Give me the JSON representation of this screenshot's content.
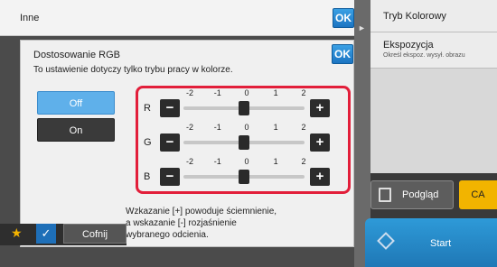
{
  "outer_dialog": {
    "title": "Inne",
    "ok_label": "OK"
  },
  "rgb_dialog": {
    "title": "Dostosowanie RGB",
    "ok_label": "OK",
    "description": "To ustawienie dotyczy tylko trybu pracy w kolorze.",
    "mode_off_label": "Off",
    "mode_on_label": "On",
    "selected_mode": "Off",
    "scale_labels": [
      "-2",
      "-1",
      "0",
      "1",
      "2"
    ],
    "channels": [
      {
        "label": "R",
        "value": 0
      },
      {
        "label": "G",
        "value": 0
      },
      {
        "label": "B",
        "value": 0
      }
    ],
    "minus_label": "−",
    "plus_label": "+",
    "note_lines": [
      "Wzkazanie [+] powoduje ściemnienie,",
      "a wskazanie [-] rozjaśnienie",
      "wybranego odcienia."
    ]
  },
  "right_panel": {
    "items": [
      {
        "title": "Tryb Kolorowy",
        "subtitle": ""
      },
      {
        "title": "Ekspozycja",
        "subtitle": "Określ ekspoz. wysył. obrazu"
      }
    ],
    "preview_label": "Podgląd",
    "ca_label": "CA",
    "start_label": "Start"
  },
  "bottom_bar": {
    "back_label": "Cofnij"
  },
  "colors": {
    "highlight": "#e21e3a",
    "selected": "#5fb0ea",
    "accent": "#1f78b6",
    "ca": "#f2b400"
  }
}
